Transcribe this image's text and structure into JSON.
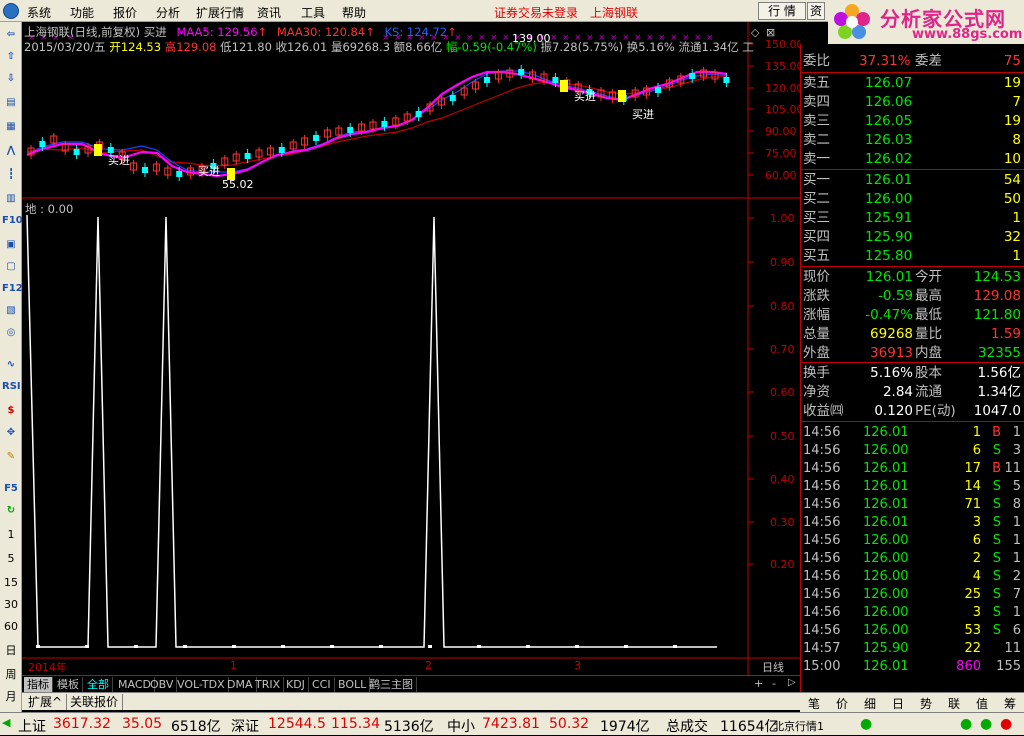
{
  "menu": {
    "items": [
      "系统",
      "功能",
      "报价",
      "分析",
      "扩展行情",
      "资讯",
      "工具",
      "帮助"
    ],
    "warning": "证券交易未登录",
    "stock_name": "上海钢联",
    "mode_button": "行 情",
    "mode_button2": "资"
  },
  "logo": {
    "title": "分析家公式网",
    "url": "www.88gs.com"
  },
  "chart": {
    "title": "上海钢联(日线,前复权) 买进",
    "ma5_label": "MAA5: 129.56",
    "ma30_label": "MAA30: 120.84",
    "ks_label": "KS: 124.72",
    "info_date": "2015/03/20/五",
    "info_open": "开124.53",
    "info_high": "高129.08",
    "info_low": "低121.80",
    "info_close": "收126.01",
    "info_vol": "量69268.3",
    "info_amt": "额8.66亿",
    "info_chg": "幅-0.59(-0.47%)",
    "info_amp": "振7.28(5.75%)",
    "info_turn": "换5.16%",
    "info_float": "流通1.34亿",
    "info_more": "工",
    "price_axis": [
      "150.00",
      "135.00",
      "120.00",
      "105.00",
      "90.00",
      "75.00",
      "60.00"
    ],
    "annot_high": "139.00",
    "annot_low": "55.02",
    "buy_label": "买进",
    "indicator_label": "地 : 0.00",
    "ind_axis": [
      "1.00",
      "0.90",
      "0.80",
      "0.70",
      "0.60",
      "0.50",
      "0.40",
      "0.30",
      "0.20"
    ],
    "time_labels": [
      "2014年",
      "1",
      "2",
      "3"
    ],
    "period_label": "日线",
    "plus": "+",
    "minus": "-"
  },
  "bottom_tabs": [
    "指标",
    "模板",
    "全部",
    "MACD",
    "OBV",
    "VOL-TDX",
    "DMA",
    "TRIX",
    "KDJ",
    "CCI",
    "BOLL",
    "鹳三主图"
  ],
  "ext_tabs": [
    "扩展^",
    "关联报价"
  ],
  "quote": {
    "weibi_label": "委比",
    "weibi": "37.31%",
    "weicha_label": "委差",
    "weicha": "75",
    "sell": [
      {
        "label": "卖五",
        "price": "126.07",
        "vol": "19"
      },
      {
        "label": "卖四",
        "price": "126.06",
        "vol": "7"
      },
      {
        "label": "卖三",
        "price": "126.05",
        "vol": "19"
      },
      {
        "label": "卖二",
        "price": "126.03",
        "vol": "8"
      },
      {
        "label": "卖一",
        "price": "126.02",
        "vol": "10"
      }
    ],
    "buy": [
      {
        "label": "买一",
        "price": "126.01",
        "vol": "54"
      },
      {
        "label": "买二",
        "price": "126.00",
        "vol": "50"
      },
      {
        "label": "买三",
        "price": "125.91",
        "vol": "1"
      },
      {
        "label": "买四",
        "price": "125.90",
        "vol": "32"
      },
      {
        "label": "买五",
        "price": "125.80",
        "vol": "1"
      }
    ],
    "stats": [
      {
        "l1": "现价",
        "v1": "126.01",
        "c1": "green",
        "l2": "今开",
        "v2": "124.53",
        "c2": "green"
      },
      {
        "l1": "涨跌",
        "v1": "-0.59",
        "c1": "green",
        "l2": "最高",
        "v2": "129.08",
        "c2": "red"
      },
      {
        "l1": "涨幅",
        "v1": "-0.47%",
        "c1": "green",
        "l2": "最低",
        "v2": "121.80",
        "c2": "green"
      },
      {
        "l1": "总量",
        "v1": "69268",
        "c1": "yellow",
        "l2": "量比",
        "v2": "1.59",
        "c2": "red"
      },
      {
        "l1": "外盘",
        "v1": "36913",
        "c1": "red",
        "l2": "内盘",
        "v2": "32355",
        "c2": "green"
      }
    ],
    "stats2": [
      {
        "l1": "换手",
        "v1": "5.16%",
        "l2": "股本",
        "v2": "1.56亿"
      },
      {
        "l1": "净资",
        "v1": "2.84",
        "l2": "流通",
        "v2": "1.34亿"
      },
      {
        "l1": "收益㈣",
        "v1": "0.120",
        "l2": "PE(动)",
        "v2": "1047.0"
      }
    ],
    "ticks": [
      {
        "t": "14:56",
        "p": "126.01",
        "pc": "green",
        "v": "1",
        "bs": "B",
        "bc": "red",
        "n": "1"
      },
      {
        "t": "14:56",
        "p": "126.00",
        "pc": "green",
        "v": "6",
        "bs": "S",
        "bc": "green",
        "n": "3"
      },
      {
        "t": "14:56",
        "p": "126.01",
        "pc": "green",
        "v": "17",
        "bs": "B",
        "bc": "red",
        "n": "11"
      },
      {
        "t": "14:56",
        "p": "126.01",
        "pc": "green",
        "v": "14",
        "bs": "S",
        "bc": "green",
        "n": "5"
      },
      {
        "t": "14:56",
        "p": "126.01",
        "pc": "green",
        "v": "71",
        "bs": "S",
        "bc": "green",
        "n": "8"
      },
      {
        "t": "14:56",
        "p": "126.01",
        "pc": "green",
        "v": "3",
        "bs": "S",
        "bc": "green",
        "n": "1"
      },
      {
        "t": "14:56",
        "p": "126.00",
        "pc": "green",
        "v": "6",
        "bs": "S",
        "bc": "green",
        "n": "1"
      },
      {
        "t": "14:56",
        "p": "126.00",
        "pc": "green",
        "v": "2",
        "bs": "S",
        "bc": "green",
        "n": "1"
      },
      {
        "t": "14:56",
        "p": "126.00",
        "pc": "green",
        "v": "4",
        "bs": "S",
        "bc": "green",
        "n": "2"
      },
      {
        "t": "14:56",
        "p": "126.00",
        "pc": "green",
        "v": "25",
        "bs": "S",
        "bc": "green",
        "n": "7"
      },
      {
        "t": "14:56",
        "p": "126.00",
        "pc": "green",
        "v": "3",
        "bs": "S",
        "bc": "green",
        "n": "1"
      },
      {
        "t": "14:56",
        "p": "126.00",
        "pc": "green",
        "v": "53",
        "bs": "S",
        "bc": "green",
        "n": "6"
      },
      {
        "t": "14:57",
        "p": "125.90",
        "pc": "green",
        "v": "22",
        "bs": "",
        "bc": "green",
        "n": "11"
      },
      {
        "t": "15:00",
        "p": "126.01",
        "pc": "green",
        "v": "860",
        "bs": "",
        "bc": "magenta",
        "n": "155"
      }
    ],
    "tabs": [
      "笔",
      "价",
      "细",
      "日",
      "势",
      "联",
      "值",
      "筹"
    ]
  },
  "status": {
    "sh_label": "上证",
    "sh_val": "3617.32",
    "sh_chg": "35.05",
    "sh_amt": "6518亿",
    "sz_label": "深证",
    "sz_val": "12544.5",
    "sz_chg": "115.34",
    "sz_amt": "5136亿",
    "zx_label": "中小",
    "zx_val": "7423.81",
    "zx_chg": "50.32",
    "zx_amt": "1974亿",
    "total_label": "总成交",
    "total_val": "11654亿",
    "feed": "北京行情1"
  },
  "toolbar_text": [
    "F5",
    "1",
    "5",
    "15",
    "30",
    "60",
    "日",
    "周",
    "月"
  ]
}
